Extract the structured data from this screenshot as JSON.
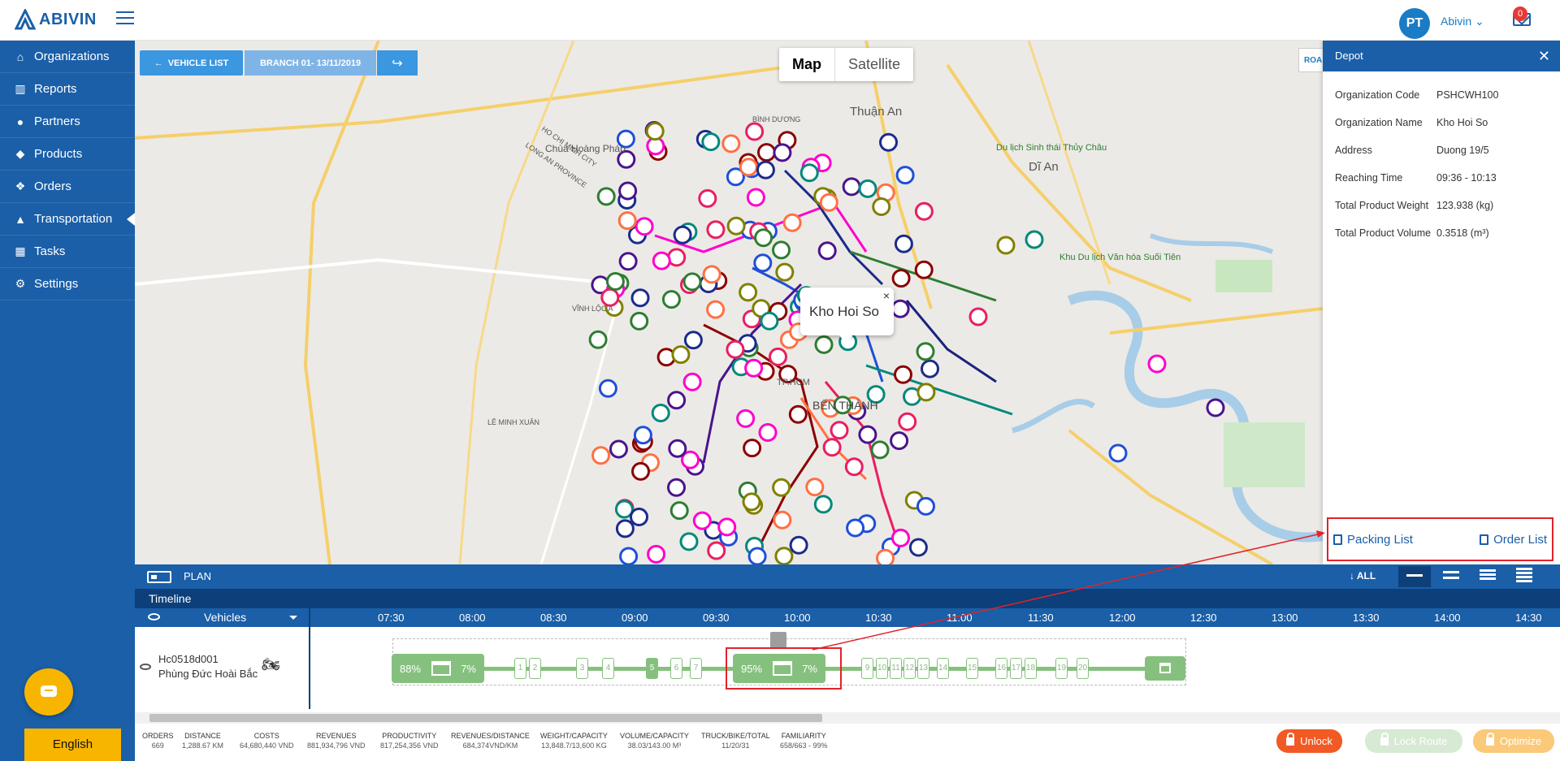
{
  "header": {
    "logo_text": "ABIVIN",
    "avatar_initials": "PT",
    "user_name": "Abivin",
    "notifications": "0"
  },
  "sidebar": {
    "items": [
      {
        "label": "Organizations",
        "icon": "home-icon"
      },
      {
        "label": "Reports",
        "icon": "chart-icon"
      },
      {
        "label": "Partners",
        "icon": "users-icon"
      },
      {
        "label": "Products",
        "icon": "dropbox-icon"
      },
      {
        "label": "Orders",
        "icon": "cubes-icon"
      },
      {
        "label": "Transportation",
        "icon": "road-icon",
        "active": true
      },
      {
        "label": "Tasks",
        "icon": "calendar-icon"
      },
      {
        "label": "Settings",
        "icon": "gear-icon"
      }
    ],
    "language": "English"
  },
  "toolbar": {
    "vehicle_list": "VEHICLE LIST",
    "branch": "BRANCH 01- 13/11/2019"
  },
  "map": {
    "type_map": "Map",
    "type_satellite": "Satellite",
    "road_btn": "ROA",
    "popup_title": "Kho Hoi So",
    "labels": [
      "Thuận An",
      "Dĩ An",
      "BÌNH DƯƠNG",
      "HO CHI MINH CITY",
      "LONG AN PROVINCE",
      "Chùa Hoàng Pháp",
      "BẾN THÀNH",
      "TP.HCM",
      "Khu Du lịch Văn hóa Suối Tiên",
      "Du lịch Sinh thái Thủy Châu",
      "LÊ MINH XUÂN",
      "VĨNH LỘC A"
    ]
  },
  "depot": {
    "title": "Depot",
    "rows": [
      {
        "k": "Organization Code",
        "v": "PSHCWH100"
      },
      {
        "k": "Organization Name",
        "v": "Kho Hoi So"
      },
      {
        "k": "Address",
        "v": "Duong 19/5"
      },
      {
        "k": "Reaching Time",
        "v": "09:36 - 10:13"
      },
      {
        "k": "Total Product Weight",
        "v": "123.938 (kg)"
      },
      {
        "k": "Total Product Volume",
        "v": "0.3518 (m³)"
      }
    ],
    "packing_list": "Packing List",
    "order_list": "Order List"
  },
  "plan": {
    "label": "PLAN",
    "all_label": "ALL"
  },
  "timeline": {
    "title": "Timeline",
    "vehicles_label": "Vehicles",
    "ticks": [
      "07:30",
      "08:00",
      "08:30",
      "09:00",
      "09:30",
      "10:00",
      "10:30",
      "11:00",
      "11:30",
      "12:00",
      "12:30",
      "13:00",
      "13:30",
      "14:00",
      "14:30"
    ],
    "vehicle": {
      "code": "Hc0518d001",
      "driver": "Phùng Đức Hoài Bắc"
    },
    "depot1": {
      "left": "88%",
      "right": "7%"
    },
    "depot2": {
      "left": "95%",
      "right": "7%"
    },
    "stops": [
      "1",
      "2",
      "3",
      "4",
      "5",
      "6",
      "7",
      "9",
      "10",
      "11",
      "12",
      "13",
      "14",
      "15",
      "16",
      "17",
      "18",
      "19",
      "20"
    ]
  },
  "stats": [
    {
      "label": "ORDERS",
      "value": "669"
    },
    {
      "label": "DISTANCE",
      "value": "1,288.67 KM"
    },
    {
      "label": "COSTS",
      "value": "64,680,440 VND"
    },
    {
      "label": "REVENUES",
      "value": "881,934,796 VND"
    },
    {
      "label": "PRODUCTIVITY",
      "value": "817,254,356 VND"
    },
    {
      "label": "REVENUES/DISTANCE",
      "value": "684,374VND/KM"
    },
    {
      "label": "WEIGHT/CAPACITY",
      "value": "13,848.7/13,600 KG"
    },
    {
      "label": "VOLUME/CAPACITY",
      "value": "38.03/143.00 M³"
    },
    {
      "label": "TRUCK/BIKE/TOTAL",
      "value": "11/20/31"
    },
    {
      "label": "FAMILIARITY",
      "value": "658/663 - 99%"
    }
  ],
  "actions": {
    "unlock": "Unlock",
    "lock_route": "Lock Route",
    "optimize": "Optimize"
  },
  "colors": {
    "primary": "#1a5fa8",
    "accent": "#f7b500",
    "route_green": "#86c07e",
    "unlock": "#f15a24",
    "highlight": "#e0232a"
  }
}
